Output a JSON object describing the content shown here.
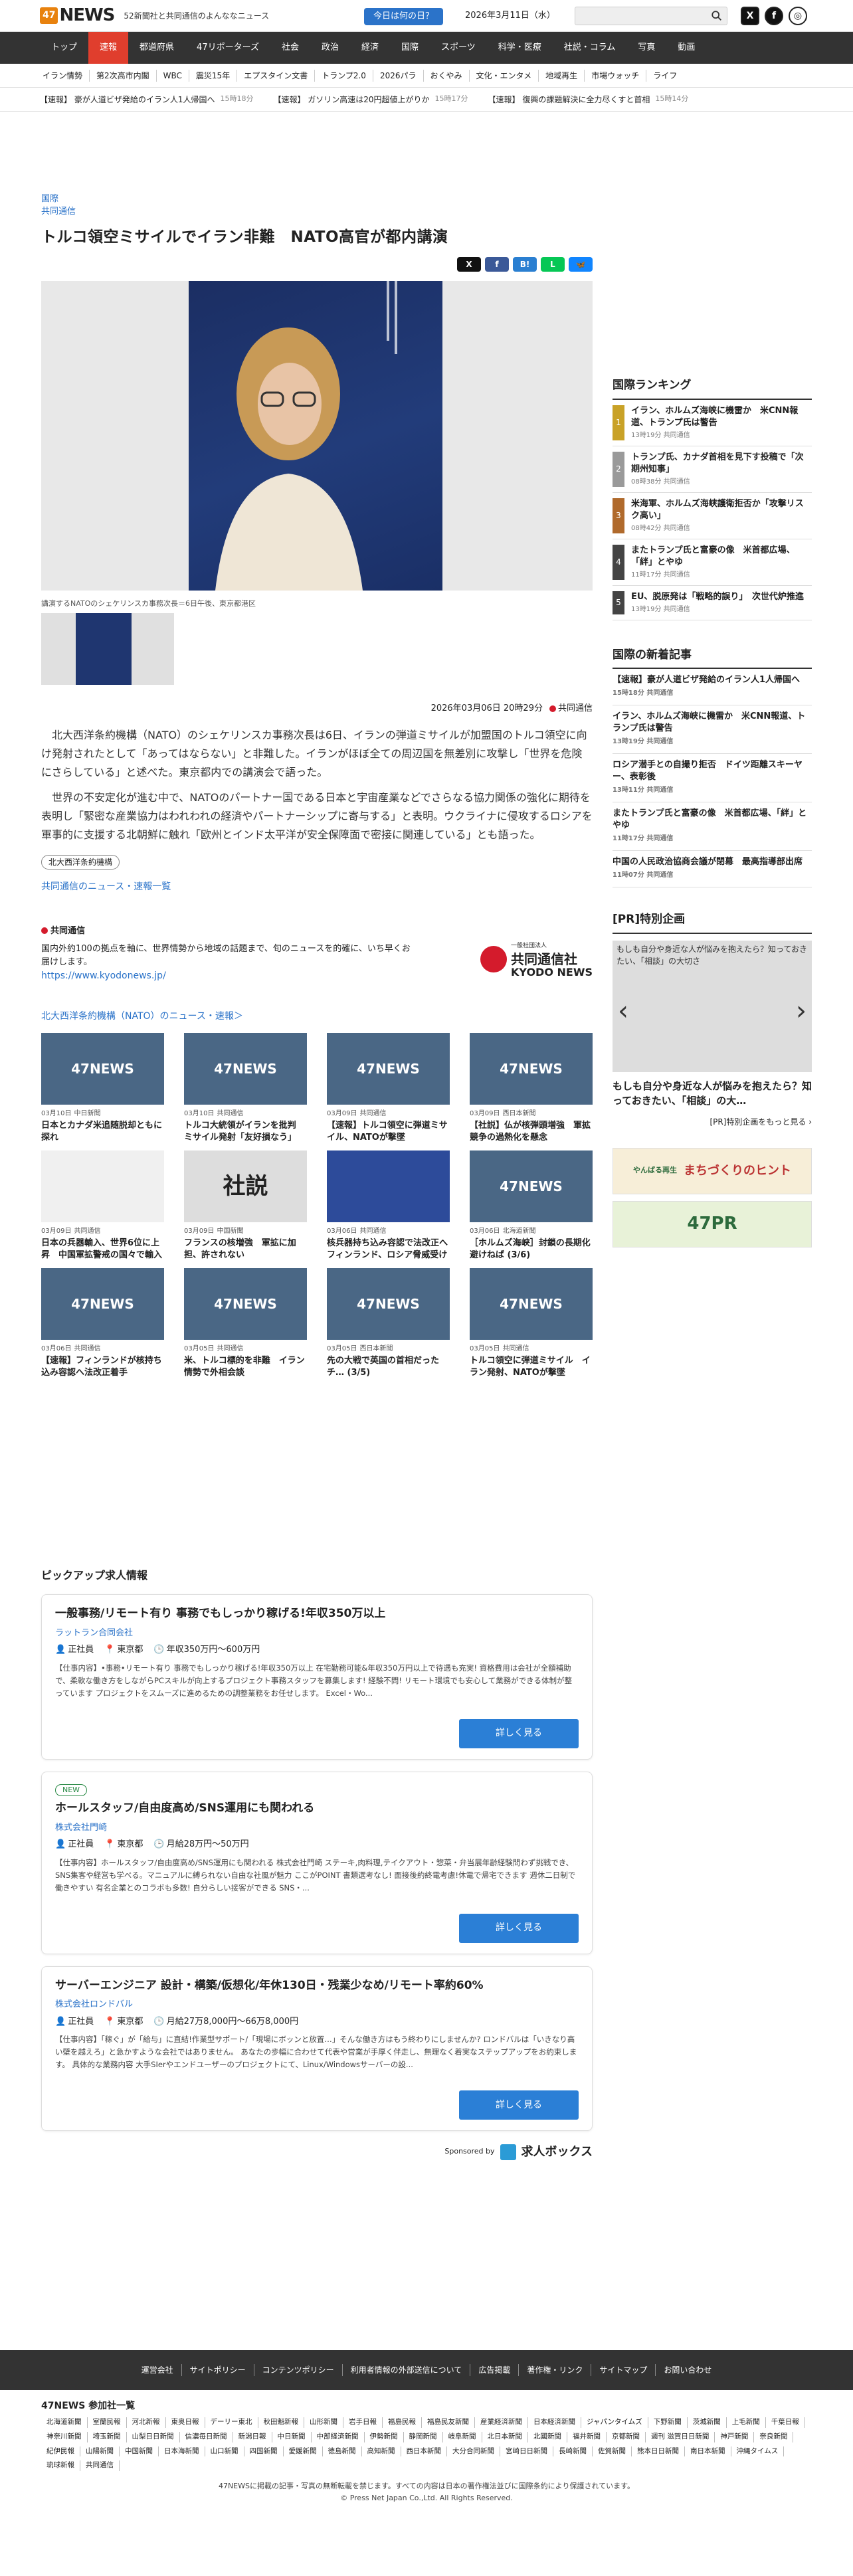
{
  "header": {
    "logo_box": "47",
    "logo_text": "NEWS",
    "tagline": "52新聞社と共同通信のよんななニュース",
    "today_button": "今日は何の日？",
    "date": "2026年3月11日（水）"
  },
  "gnav": [
    "トップ",
    "速報",
    "都道府県",
    "47リポーターズ",
    "社会",
    "政治",
    "経済",
    "国際",
    "スポーツ",
    "科学・医療",
    "社説・コラム",
    "写真",
    "動画"
  ],
  "subnav": [
    "イラン情勢",
    "第2次高市内閣",
    "WBC",
    "震災15年",
    "エプスタイン文書",
    "トランプ2.0",
    "2026パラ",
    "おくやみ",
    "文化・エンタメ",
    "地域再生",
    "市場ウォッチ",
    "ライフ"
  ],
  "ticker": [
    {
      "text": "【速報】 豪が人道ビザ発給のイラン人1人帰国へ",
      "time": "15時18分"
    },
    {
      "text": "【速報】 ガソリン高速は20円超値上がりか",
      "time": "15時17分"
    },
    {
      "text": "【速報】 復興の課題解決に全力尽くすと首相",
      "time": "15時14分"
    }
  ],
  "article": {
    "category1": "国際",
    "category2": "共同通信",
    "title": "トルコ領空ミサイルでイラン非難　NATO高官が都内講演",
    "share": [
      "X",
      "f",
      "B!",
      "L",
      "🦋"
    ],
    "caption": "講演するNATOのシェケリンスカ事務次長＝6日午後、東京都港区",
    "datetime": "2026年03月06日 20時29分",
    "source": "共同通信",
    "paragraphs": [
      "北大西洋条約機構（NATO）のシェケリンスカ事務次長は6日、イランの弾道ミサイルが加盟国のトルコ領空に向け発射されたとして「あってはならない」と非難した。イランがほぼ全ての周辺国を無差別に攻撃し「世界を危険にさらしている」と述べた。東京都内での講演会で語った。",
      "世界の不安定化が進む中で、NATOのパートナー国である日本と宇宙産業などでさらなる協力関係の強化に期待を表明し「緊密な産業協力はわれわれの経済やパートナーシップに寄与する」と表明。ウクライナに侵攻するロシアを軍事的に支援する北朝鮮に触れ「欧州とインド太平洋が安全保障面で密接に関連している」とも語った。"
    ],
    "tag": "北大西洋条約機構",
    "more_link": "共同通信のニュース・速報一覧"
  },
  "kyodo": {
    "source": "共同通信",
    "desc": "国内外約100の拠点を軸に、世界情勢から地域の話題まで、旬のニュースを的確に、いち早くお届けします。",
    "url": "https://www.kyodonews.jp/",
    "logo_jp": "共同通信社",
    "logo_en": "KYODO NEWS",
    "logo_small": "一般社団法人"
  },
  "related": {
    "title": "北大西洋条約機構（NATO）のニュース・速報＞",
    "cards": [
      {
        "img": "47NEWS",
        "kind": "n",
        "date": "03月10日",
        "src": "中日新聞",
        "title": "日本とカナダ米追随脱却ともに探れ"
      },
      {
        "img": "47NEWS",
        "kind": "n",
        "date": "03月10日",
        "src": "共同通信",
        "title": "トルコ大統領がイランを批判　ミサイル発射「友好損なう」"
      },
      {
        "img": "47NEWS",
        "kind": "n",
        "date": "03月09日",
        "src": "共同通信",
        "title": "【速報】トルコ領空に弾道ミサイル、NATOが撃墜"
      },
      {
        "img": "47NEWS",
        "kind": "n",
        "date": "03月09日",
        "src": "西日本新聞",
        "title": "【社説】仏が核弾頭増強　軍拡競争の過熱化を懸念"
      },
      {
        "img": "",
        "kind": "chart",
        "date": "03月09日",
        "src": "共同通信",
        "title": "日本の兵器輸入、世界6位に上昇　中国軍拡警戒の国々で輸入量増加"
      },
      {
        "img": "社説",
        "kind": "art",
        "date": "03月09日",
        "src": "中国新聞",
        "title": "フランスの核増強　軍拡に加担、許されない"
      },
      {
        "img": "",
        "kind": "eu",
        "date": "03月06日",
        "src": "共同通信",
        "title": "核兵器持ち込み容認で法改正へ　フィンランド、ロシア脅威受け"
      },
      {
        "img": "47NEWS",
        "kind": "n",
        "date": "03月06日",
        "src": "北海道新聞",
        "title": "［ホルムズ海峡］封鎖の長期化　避けねば (3/6)"
      },
      {
        "img": "47NEWS",
        "kind": "n",
        "date": "03月06日",
        "src": "共同通信",
        "title": "【速報】フィンランドが核持ち込み容認へ法改正着手"
      },
      {
        "img": "47NEWS",
        "kind": "n",
        "date": "03月05日",
        "src": "共同通信",
        "title": "米、トルコ標的を非難　イラン情勢で外相会談"
      },
      {
        "img": "47NEWS",
        "kind": "n",
        "date": "03月05日",
        "src": "西日本新聞",
        "title": "先の大戦で英国の首相だったチ… (3/5)"
      },
      {
        "img": "47NEWS",
        "kind": "n",
        "date": "03月05日",
        "src": "共同通信",
        "title": "トルコ領空に弾道ミサイル　イラン発射、NATOが撃墜"
      }
    ]
  },
  "ranking": {
    "title": "国際ランキング",
    "items": [
      {
        "no": "1",
        "color": "#c9a227",
        "title": "イラン、ホルムズ海峡に機雷か　米CNN報道、トランプ氏は警告",
        "time": "13時19分",
        "src": "共同通信"
      },
      {
        "no": "2",
        "color": "#9a9a9a",
        "title": "トランプ氏、カナダ首相を見下す投稿で「次期州知事」",
        "time": "08時38分",
        "src": "共同通信"
      },
      {
        "no": "3",
        "color": "#b06a2c",
        "title": "米海軍、ホルムズ海峡護衛拒否か「攻撃リスク高い」",
        "time": "08時42分",
        "src": "共同通信"
      },
      {
        "no": "4",
        "color": "#444",
        "title": "またトランプ氏と富豪の像　米首都広場、「絆」とやゆ",
        "time": "11時17分",
        "src": "共同通信"
      },
      {
        "no": "5",
        "color": "#444",
        "title": "EU、脱原発は「戦略的誤り」　次世代炉推進",
        "time": "13時19分",
        "src": "共同通信"
      }
    ]
  },
  "latest": {
    "title": "国際の新着記事",
    "items": [
      {
        "title": "【速報】豪が人道ビザ発給のイラン人1人帰国へ",
        "time": "15時18分",
        "src": "共同通信"
      },
      {
        "title": "イラン、ホルムズ海峡に機雷か　米CNN報道、トランプ氏は警告",
        "time": "13時19分",
        "src": "共同通信"
      },
      {
        "title": "ロシア潜手との自撮り拒否　ドイツ距離スキーヤー、表彰後",
        "time": "13時11分",
        "src": "共同通信"
      },
      {
        "title": "またトランプ氏と富豪の像　米首都広場、「絆」とやゆ",
        "time": "11時17分",
        "src": "共同通信"
      },
      {
        "title": "中国の人民政治協商会議が閉幕　最高指導部出席",
        "time": "11時07分",
        "src": "共同通信"
      }
    ]
  },
  "pr": {
    "title": "[PR]特別企画",
    "img_alt": "もしも自分や身近な人が悩みを抱えたら？知っておきたい、「相談」の大切さ",
    "caption": "もしも自分や身近な人が悩みを抱えたら？知っておきたい、「相談」の大…",
    "more": "[PR]特別企画をもっと見る ›",
    "banner1": "まちづくりのヒント",
    "banner1_sub": "やんばる再生",
    "banner2": "47PR"
  },
  "jobs": {
    "title": "ピックアップ求人情報",
    "items": [
      {
        "new": "",
        "title": "一般事務/リモート有り 事務でもしっかり稼げる!年収350万以上",
        "company": "ラットラン合同会社",
        "type": "正社員",
        "place": "東京都",
        "salary": "年収350万円〜600万円",
        "desc": "【仕事内容】•事務•リモート有り 事務でもしっかり稼げる!年収350万以上 在宅勤務可能&年収350万円以上で待遇も充実! 資格費用は会社が全額補助で、柔軟な働き方をしながらPCスキルが向上するプロジェクト事務スタッフを募集します! 経験不問! リモート環境でも安心して業務ができる体制が整っています プロジェクトをスムーズに進めるための調整業務をお任せします。 Excel・Wo...",
        "btn": "詳しく見る"
      },
      {
        "new": "NEW",
        "title": "ホールスタッフ/自由度高め/SNS運用にも関われる",
        "company": "株式会社門崎",
        "type": "正社員",
        "place": "東京都",
        "salary": "月給28万円〜50万円",
        "desc": "【仕事内容】ホールスタッフ/自由度高め/SNS運用にも関われる 株式会社門崎 ステーキ,肉料理,テイクアウト・惣菜・弁当展年齢経験問わず挑戦でき、SNS集客や経営も学べる。マニュアルに縛られない自由な社風が魅力 ここがPOINT 書類選考なし! 面接後約終電考慮!休電で帰宅できます 週休二日制で働きやすい 有名企業とのコラボも多数! 自分らしい接客ができる SNS・...",
        "btn": "詳しく見る"
      },
      {
        "new": "",
        "title": "サーバーエンジニア 設計・構築/仮想化/年休130日・残業少なめ/リモート率約60%",
        "company": "株式会社ロンドバル",
        "type": "正社員",
        "place": "東京都",
        "salary": "月給27万8,000円〜66万8,000円",
        "desc": "【仕事内容】「稼ぐ」が「給与」に直結!作業型サポート/「現場にボッンと放置…」そんな働き方はもう終わりにしませんか? ロンドバルは「いきなり高い壁を越えろ」と急かすような会社ではありません。 あなたの歩幅に合わせて代表や営業が手厚く伴走し、無理なく着実なステップアップをお約束します。 具体的な業務内容 大手SIerやエンドユーザーのプロジェクトにて、Linux/Windowsサーバーの設...",
        "btn": "詳しく見る"
      }
    ],
    "sponsor_label": "Sponsored by",
    "sponsor_logo": "求人ボックス"
  },
  "footer": {
    "nav": [
      "運営会社",
      "サイトポリシー",
      "コンテンツポリシー",
      "利用者情報の外部送信について",
      "広告掲載",
      "著作権・リンク",
      "サイトマップ",
      "お問い合わせ"
    ],
    "members_title": "47NEWS 参加社一覧",
    "members": [
      "北海道新聞",
      "室蘭民報",
      "河北新報",
      "東奥日報",
      "デーリー東北",
      "秋田魁新報",
      "山形新聞",
      "岩手日報",
      "福島民報",
      "福島民友新聞",
      "産業経済新聞",
      "日本経済新聞",
      "ジャパンタイムズ",
      "下野新聞",
      "茨城新聞",
      "上毛新聞",
      "千葉日報",
      "神奈川新聞",
      "埼玉新聞",
      "山梨日日新聞",
      "信濃毎日新聞",
      "新潟日報",
      "中日新聞",
      "中部経済新聞",
      "伊勢新聞",
      "静岡新聞",
      "岐阜新聞",
      "北日本新聞",
      "北國新聞",
      "福井新聞",
      "京都新聞",
      "週刊 滋賀日日新聞",
      "神戸新聞",
      "奈良新聞",
      "紀伊民報",
      "山陽新聞",
      "中国新聞",
      "日本海新聞",
      "山口新聞",
      "四国新聞",
      "愛媛新聞",
      "徳島新聞",
      "高知新聞",
      "西日本新聞",
      "大分合同新聞",
      "宮崎日日新聞",
      "長崎新聞",
      "佐賀新聞",
      "熊本日日新聞",
      "南日本新聞",
      "沖縄タイムス",
      "琉球新報",
      "共同通信"
    ],
    "copy1": "47NEWSに掲載の記事・写真の無断転載を禁じます。すべての内容は日本の著作権法並びに国際条約により保護されています。",
    "copy2": "© Press Net Japan Co.,Ltd. All Rights Reserved."
  },
  "colors": {
    "accent": "#e03e2d",
    "link": "#2b73c9",
    "logo": "#e8820e",
    "button": "#2b7fd6"
  }
}
